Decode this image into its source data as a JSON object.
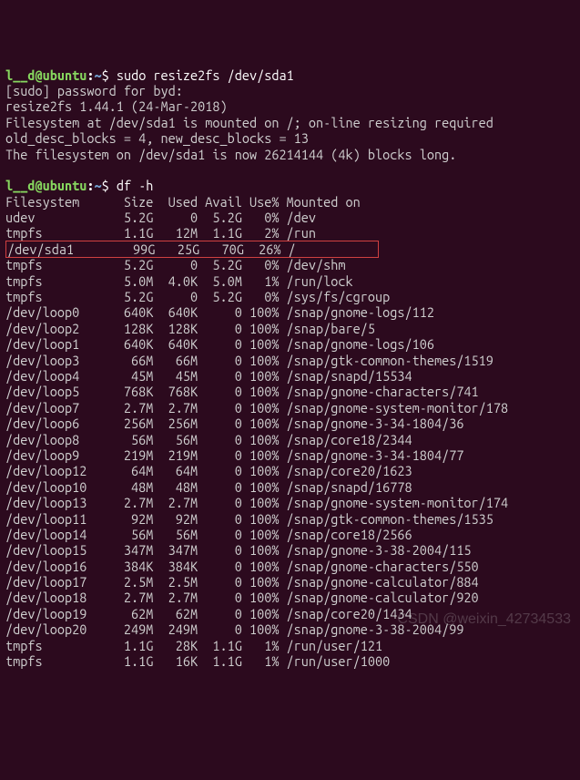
{
  "prompt1": {
    "user_host": "l__d@ubuntu",
    "path": "~",
    "command": "sudo resize2fs /dev/sda1"
  },
  "resize_output": {
    "line1": "[sudo] password for byd:",
    "line2": "resize2fs 1.44.1 (24-Mar-2018)",
    "line3": "Filesystem at /dev/sda1 is mounted on /; on-line resizing required",
    "line4": "old_desc_blocks = 4, new_desc_blocks = 13",
    "line5": "The filesystem on /dev/sda1 is now 26214144 (4k) blocks long."
  },
  "prompt2": {
    "user_host": "l__d@ubuntu",
    "path": "~",
    "command": "df -h"
  },
  "df": {
    "header": "Filesystem      Size  Used Avail Use% Mounted on",
    "rows": [
      "udev            5.2G     0  5.2G   0% /dev",
      "tmpfs           1.1G   12M  1.1G   2% /run",
      "/dev/sda1        99G   25G   70G  26% /",
      "tmpfs           5.2G     0  5.2G   0% /dev/shm",
      "tmpfs           5.0M  4.0K  5.0M   1% /run/lock",
      "tmpfs           5.2G     0  5.2G   0% /sys/fs/cgroup",
      "/dev/loop0      640K  640K     0 100% /snap/gnome-logs/112",
      "/dev/loop2      128K  128K     0 100% /snap/bare/5",
      "/dev/loop1      640K  640K     0 100% /snap/gnome-logs/106",
      "/dev/loop3       66M   66M     0 100% /snap/gtk-common-themes/1519",
      "/dev/loop4       45M   45M     0 100% /snap/snapd/15534",
      "/dev/loop5      768K  768K     0 100% /snap/gnome-characters/741",
      "/dev/loop7      2.7M  2.7M     0 100% /snap/gnome-system-monitor/178",
      "/dev/loop6      256M  256M     0 100% /snap/gnome-3-34-1804/36",
      "/dev/loop8       56M   56M     0 100% /snap/core18/2344",
      "/dev/loop9      219M  219M     0 100% /snap/gnome-3-34-1804/77",
      "/dev/loop12      64M   64M     0 100% /snap/core20/1623",
      "/dev/loop10      48M   48M     0 100% /snap/snapd/16778",
      "/dev/loop13     2.7M  2.7M     0 100% /snap/gnome-system-monitor/174",
      "/dev/loop11      92M   92M     0 100% /snap/gtk-common-themes/1535",
      "/dev/loop14      56M   56M     0 100% /snap/core18/2566",
      "/dev/loop15     347M  347M     0 100% /snap/gnome-3-38-2004/115",
      "/dev/loop16     384K  384K     0 100% /snap/gnome-characters/550",
      "/dev/loop17     2.5M  2.5M     0 100% /snap/gnome-calculator/884",
      "/dev/loop18     2.7M  2.7M     0 100% /snap/gnome-calculator/920",
      "/dev/loop19      62M   62M     0 100% /snap/core20/1434",
      "/dev/loop20     249M  249M     0 100% /snap/gnome-3-38-2004/99",
      "tmpfs           1.1G   28K  1.1G   1% /run/user/121",
      "tmpfs           1.1G   16K  1.1G   1% /run/user/1000"
    ],
    "highlight_index": 2
  },
  "watermark": "CSDN @weixin_42734533"
}
